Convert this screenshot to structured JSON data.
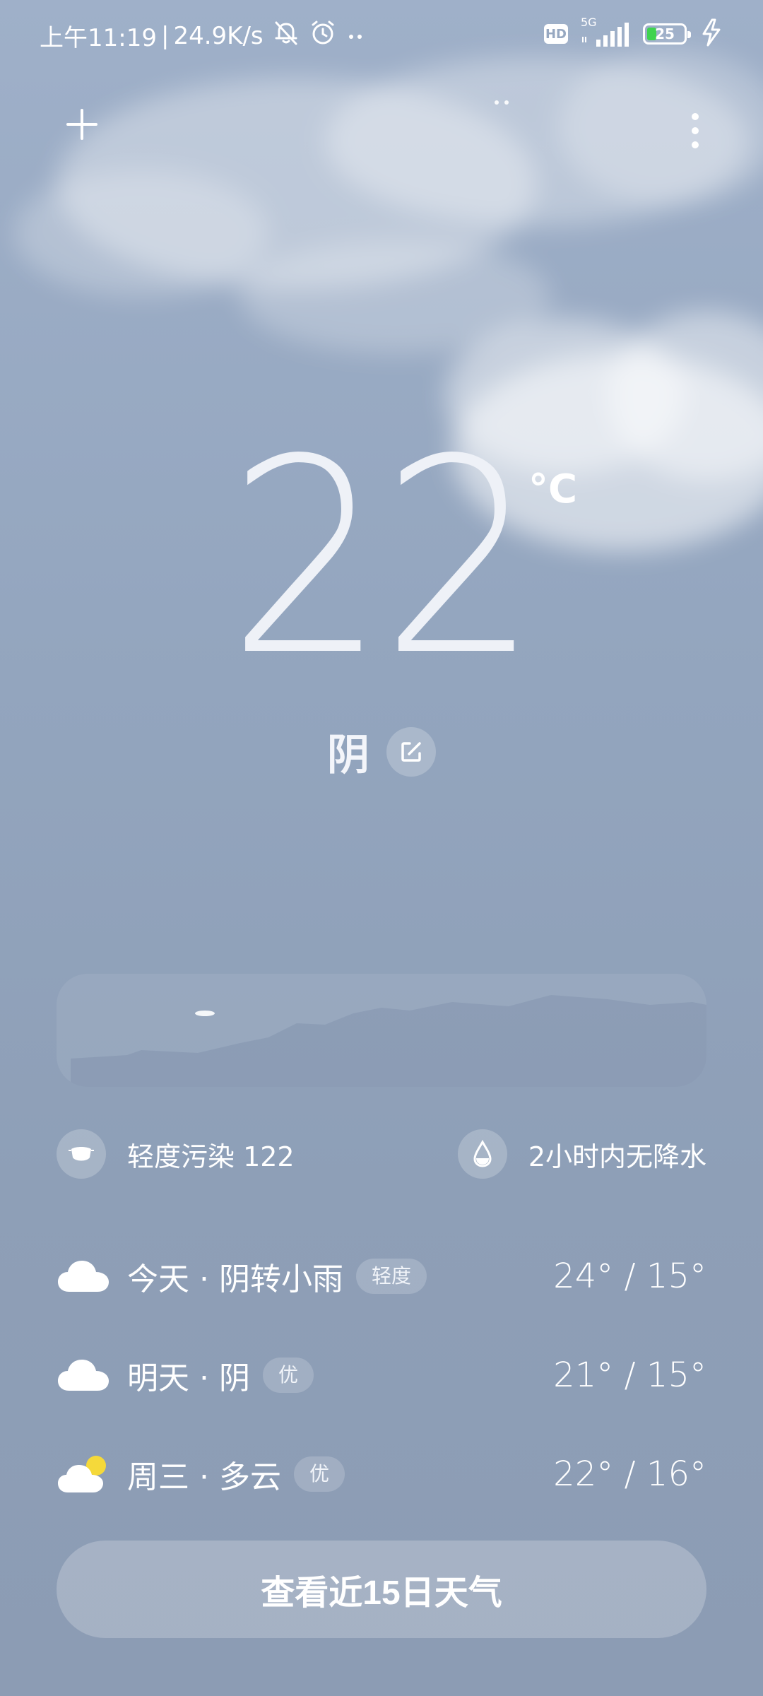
{
  "status_bar": {
    "time": "上午11:19",
    "net_speed": "24.9K/s",
    "network_type": "5G",
    "hd_label": "HD",
    "battery_level": "25",
    "battery_fraction": 0.25
  },
  "header": {
    "add_icon": "plus-icon",
    "more_icon": "more-vertical-icon"
  },
  "current": {
    "temperature": "22",
    "unit": "°C",
    "condition": "阴"
  },
  "info": {
    "air_quality": "轻度污染 122",
    "precipitation": "2小时内无降水"
  },
  "forecast": [
    {
      "label": "今天 · 阴转小雨",
      "badge": "轻度",
      "temps": "24° / 15°",
      "icon": "cloud-icon"
    },
    {
      "label": "明天 · 阴",
      "badge": "优",
      "temps": "21° / 15°",
      "icon": "cloud-icon"
    },
    {
      "label": "周三 · 多云",
      "badge": "优",
      "temps": "22° / 16°",
      "icon": "partly-cloudy-icon"
    }
  ],
  "cta": {
    "label": "查看近15日天气"
  },
  "colors": {
    "background": "#93a5be",
    "text": "#ffffff",
    "battery_fill": "#3fd34f",
    "sun": "#f5d93a"
  }
}
